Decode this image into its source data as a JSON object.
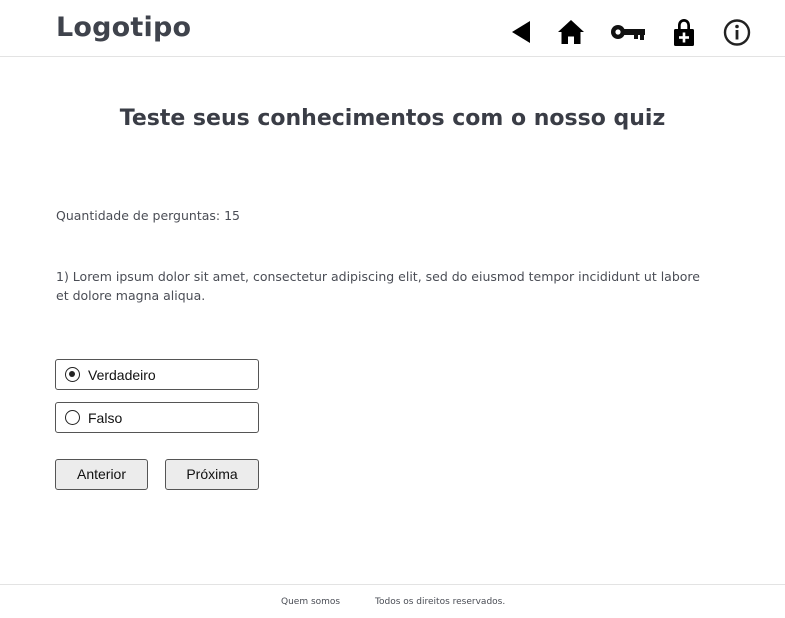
{
  "header": {
    "logo": "Logotipo",
    "icons": [
      "back-arrow-icon",
      "home-icon",
      "key-icon",
      "lock-icon",
      "info-icon"
    ]
  },
  "main": {
    "title": "Teste seus conhecimentos com o nosso quiz",
    "question_count": "Quantidade de perguntas: 15",
    "question_text": "1) Lorem ipsum dolor sit amet, consectetur adipiscing elit, sed do eiusmod tempor incididunt ut labore et dolore magna aliqua.",
    "options": [
      {
        "label": "Verdadeiro",
        "selected": true
      },
      {
        "label": "Falso",
        "selected": false
      }
    ],
    "buttons": {
      "previous": "Anterior",
      "next": "Próxima"
    }
  },
  "footer": {
    "about": "Quem somos",
    "rights": "Todos os direitos reservados."
  }
}
